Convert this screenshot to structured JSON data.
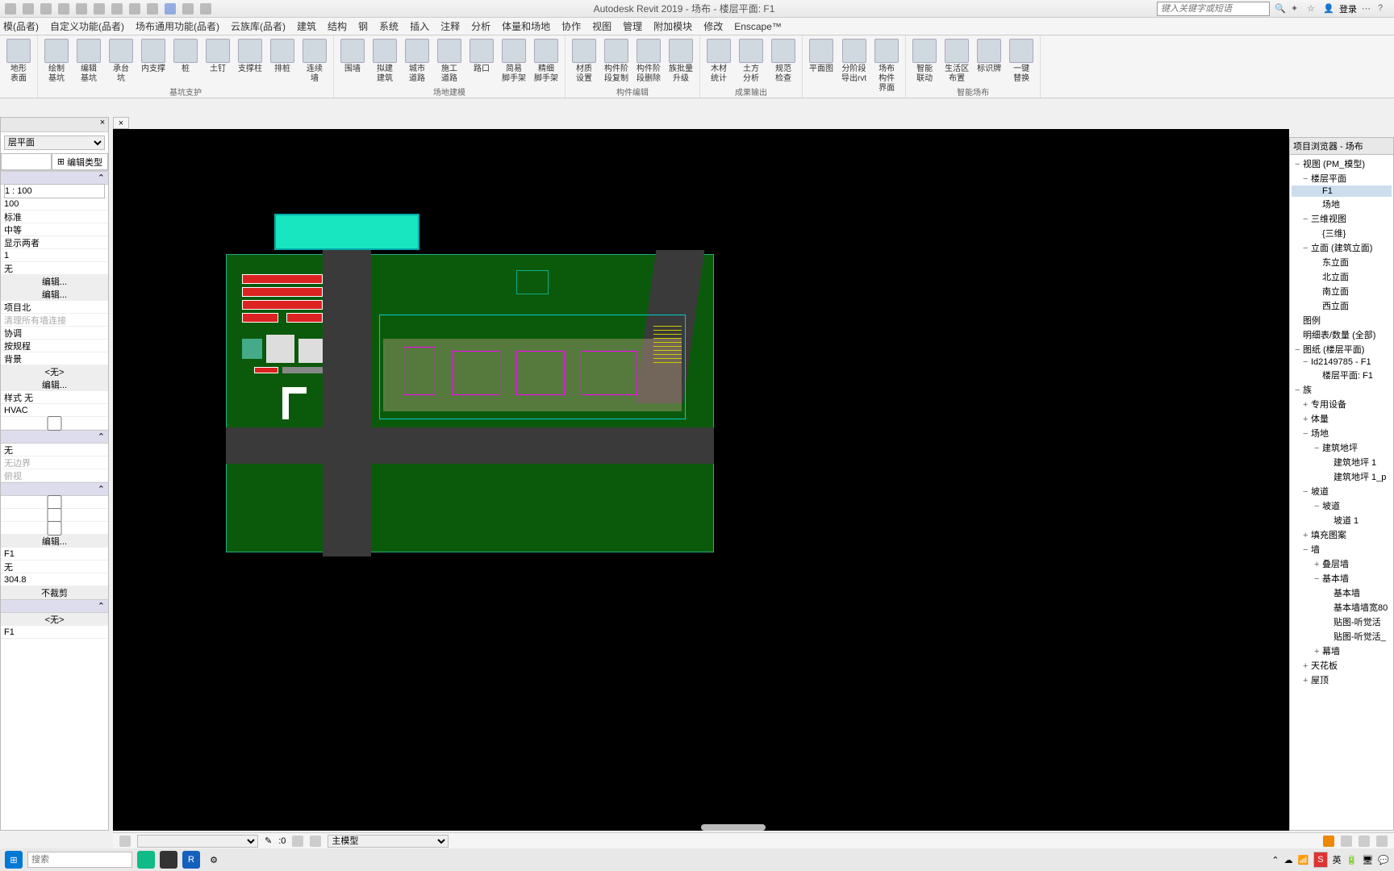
{
  "app_title": "Autodesk Revit 2019 - 场布 - 楼层平面: F1",
  "search_placeholder": "键入关键字或短语",
  "login_label": "登录",
  "tabs": [
    "模(品者)",
    "自定义功能(品者)",
    "场布通用功能(品者)",
    "云族库(品者)",
    "建筑",
    "结构",
    "钢",
    "系统",
    "插入",
    "注释",
    "分析",
    "体量和场地",
    "协作",
    "视图",
    "管理",
    "附加模块",
    "修改",
    "Enscape™"
  ],
  "ribbon_tools": {
    "g1": [
      {
        "l": "地形\n表面"
      }
    ],
    "g2": [
      {
        "l": "绘制\n基坑"
      },
      {
        "l": "编辑\n基坑"
      },
      {
        "l": "承台\n坑"
      },
      {
        "l": "内支撑"
      },
      {
        "l": "桩"
      },
      {
        "l": "土钉"
      },
      {
        "l": "支撑柱"
      },
      {
        "l": "排桩"
      },
      {
        "l": "连续\n墙"
      }
    ],
    "g2_label": "基坑支护",
    "g3": [
      {
        "l": "围墙"
      },
      {
        "l": "拟建\n建筑"
      },
      {
        "l": "城市\n道路"
      },
      {
        "l": "施工\n道路"
      },
      {
        "l": "路口"
      },
      {
        "l": "简易\n脚手架"
      },
      {
        "l": "精细\n脚手架"
      }
    ],
    "g3_label": "场地建模",
    "g4": [
      {
        "l": "材质\n设置"
      },
      {
        "l": "构件阶\n段复制"
      },
      {
        "l": "构件阶\n段删除"
      },
      {
        "l": "族批量\n升级"
      }
    ],
    "g4_label": "构件编辑",
    "g5": [
      {
        "l": "木材\n统计"
      },
      {
        "l": "土方\n分析"
      },
      {
        "l": "规范\n检查"
      }
    ],
    "g5_label": "成果输出",
    "g6": [
      {
        "l": "平面图"
      },
      {
        "l": "分阶段\n导出rvt"
      },
      {
        "l": "场布\n构件\n界面"
      }
    ],
    "g7": [
      {
        "l": "智能\n联动"
      },
      {
        "l": "生活区\n布置"
      },
      {
        "l": "标识牌"
      },
      {
        "l": "一键\n替换"
      }
    ],
    "g7_label": "智能场布"
  },
  "left_panel": {
    "view_type": "层平面",
    "edit_type": "编辑类型",
    "rows": [
      "1 : 100",
      "100",
      "标准",
      "中等",
      "显示两者",
      "1",
      "无"
    ],
    "edit_btn": "编辑...",
    "rows2": [
      "项目北",
      "清理所有墙连接",
      "协调",
      "按规程",
      "背景"
    ],
    "none_sel": "<无>",
    "rows3_label": "样式",
    "rows3_val": "无",
    "hvac": "HVAC",
    "rows4": [
      "无",
      "无边界",
      "俯视"
    ],
    "f1": "F1",
    "wu": "无",
    "num": "304.8",
    "nocrop": "不裁剪",
    "none2": "<无>",
    "f1b": "F1"
  },
  "browser": {
    "title": "项目浏览器 - 场布",
    "nodes": [
      {
        "t": "视图 (PM_模型)",
        "d": 0,
        "e": "−"
      },
      {
        "t": "楼层平面",
        "d": 1,
        "e": "−"
      },
      {
        "t": "F1",
        "d": 2,
        "sel": true
      },
      {
        "t": "场地",
        "d": 2
      },
      {
        "t": "三维视图",
        "d": 1,
        "e": "−"
      },
      {
        "t": "{三维}",
        "d": 2
      },
      {
        "t": "立面 (建筑立面)",
        "d": 1,
        "e": "−"
      },
      {
        "t": "东立面",
        "d": 2
      },
      {
        "t": "北立面",
        "d": 2
      },
      {
        "t": "南立面",
        "d": 2
      },
      {
        "t": "西立面",
        "d": 2
      },
      {
        "t": "图例",
        "d": 0,
        "e": ""
      },
      {
        "t": "明细表/数量 (全部)",
        "d": 0,
        "e": ""
      },
      {
        "t": "图纸 (楼层平面)",
        "d": 0,
        "e": "−"
      },
      {
        "t": "Id2149785 - F1",
        "d": 1,
        "e": "−"
      },
      {
        "t": "楼层平面: F1",
        "d": 2
      },
      {
        "t": "族",
        "d": 0,
        "e": "−"
      },
      {
        "t": "专用设备",
        "d": 1,
        "e": "+"
      },
      {
        "t": "体量",
        "d": 1,
        "e": "+"
      },
      {
        "t": "场地",
        "d": 1,
        "e": "−"
      },
      {
        "t": "建筑地坪",
        "d": 2,
        "e": "−"
      },
      {
        "t": "建筑地坪 1",
        "d": 3
      },
      {
        "t": "建筑地坪 1_p",
        "d": 3
      },
      {
        "t": "坡道",
        "d": 1,
        "e": "−"
      },
      {
        "t": "坡道",
        "d": 2,
        "e": "−"
      },
      {
        "t": "坡道 1",
        "d": 3
      },
      {
        "t": "填充图案",
        "d": 1,
        "e": "+"
      },
      {
        "t": "墙",
        "d": 1,
        "e": "−"
      },
      {
        "t": "叠层墙",
        "d": 2,
        "e": "+"
      },
      {
        "t": "基本墙",
        "d": 2,
        "e": "−"
      },
      {
        "t": "基本墙",
        "d": 3
      },
      {
        "t": "基本墙墙宽80",
        "d": 3
      },
      {
        "t": "贴图-听觉活",
        "d": 3
      },
      {
        "t": "贴图-听觉活_",
        "d": 3
      },
      {
        "t": "幕墙",
        "d": 2,
        "e": "+"
      },
      {
        "t": "天花板",
        "d": 1,
        "e": "+"
      },
      {
        "t": "屋顶",
        "d": 1,
        "e": "+"
      }
    ]
  },
  "status": {
    "zero": ":0",
    "main_model": "主模型"
  },
  "taskbar": {
    "search": "搜索",
    "ime": "英"
  }
}
